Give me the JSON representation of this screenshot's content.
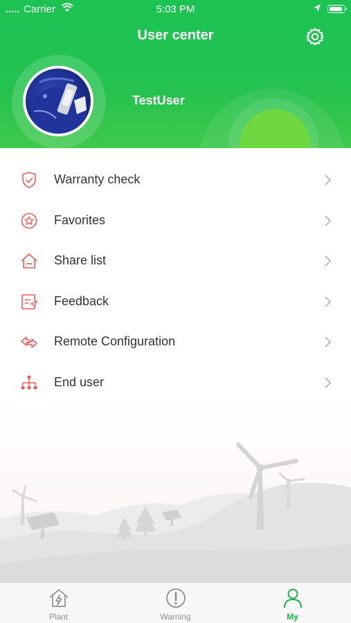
{
  "status_bar": {
    "carrier": "Carrier",
    "time": "5:03 PM"
  },
  "header": {
    "title": "User center",
    "username": "TestUser",
    "icons": [
      "gear-icon",
      "avatar"
    ]
  },
  "menu": {
    "items": [
      {
        "label": "Warranty check",
        "icon": "shield-check-icon"
      },
      {
        "label": "Favorites",
        "icon": "star-icon"
      },
      {
        "label": "Share list",
        "icon": "home-share-icon"
      },
      {
        "label": "Feedback",
        "icon": "feedback-icon"
      },
      {
        "label": "Remote Configuration",
        "icon": "remote-config-icon"
      },
      {
        "label": "End user",
        "icon": "org-tree-icon"
      }
    ]
  },
  "tabbar": {
    "tabs": [
      {
        "label": "Plant",
        "icon": "plant-house-icon",
        "active": false
      },
      {
        "label": "Warning",
        "icon": "warning-icon",
        "active": false
      },
      {
        "label": "My",
        "icon": "person-icon",
        "active": true
      }
    ]
  },
  "colors": {
    "accent": "#1cb14a",
    "header_green": "#22c250",
    "menu_icon": "#ee5b5b"
  }
}
